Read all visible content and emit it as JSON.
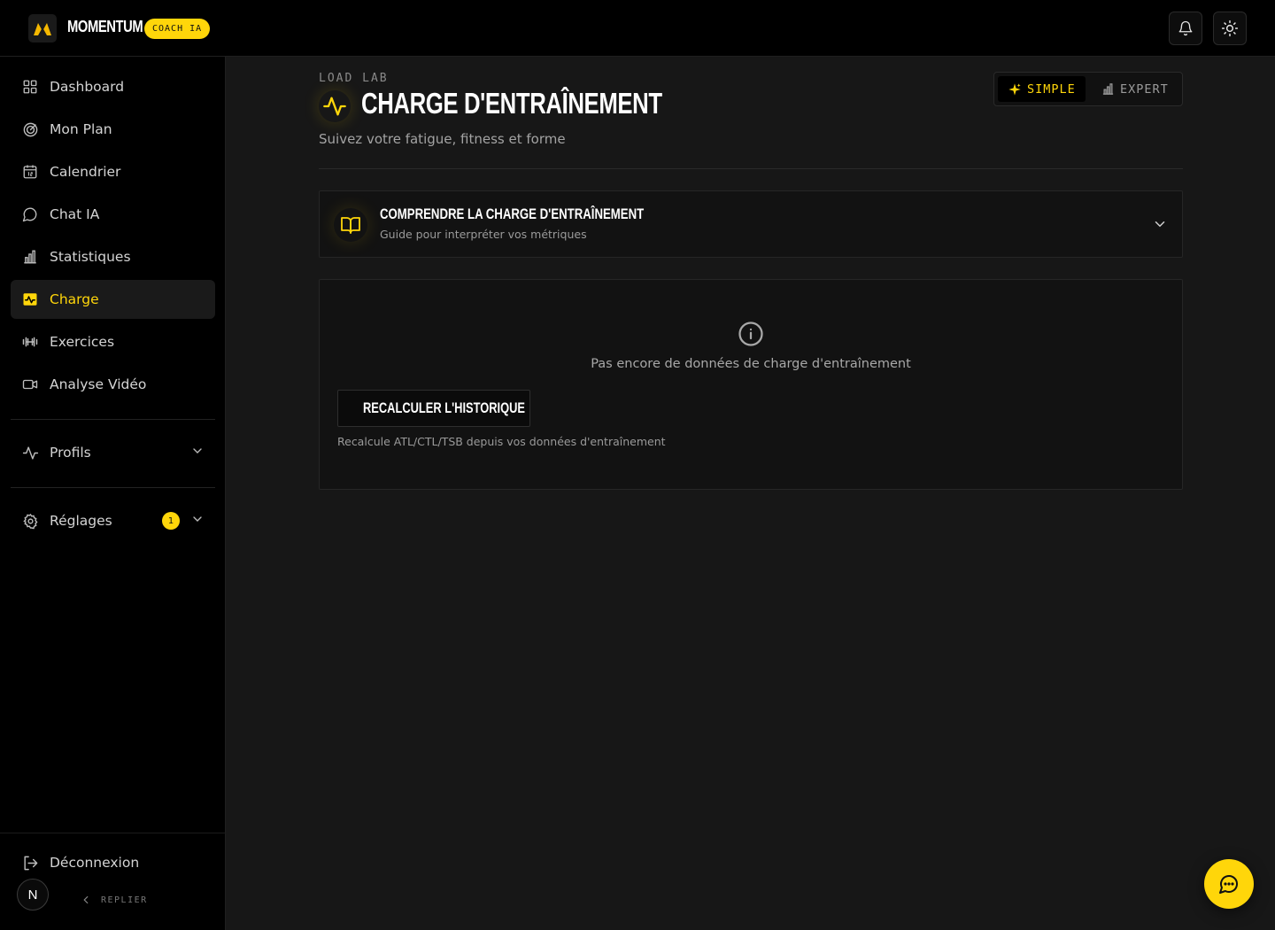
{
  "app": {
    "brand": "MOMENTUM",
    "badge": "COACH IA"
  },
  "sidebar": {
    "items": [
      {
        "label": "Dashboard",
        "icon": "grid-icon"
      },
      {
        "label": "Mon Plan",
        "icon": "target-icon"
      },
      {
        "label": "Calendrier",
        "icon": "calendar-icon"
      },
      {
        "label": "Chat IA",
        "icon": "chat-bubble-icon"
      },
      {
        "label": "Statistiques",
        "icon": "bar-chart-icon"
      },
      {
        "label": "Charge",
        "icon": "activity-icon",
        "active": true
      },
      {
        "label": "Exercices",
        "icon": "dumbbell-icon"
      },
      {
        "label": "Analyse Vidéo",
        "icon": "video-icon"
      }
    ],
    "profils": {
      "label": "Profils"
    },
    "reglages": {
      "label": "Réglages",
      "badge": "1"
    },
    "logout": {
      "label": "Déconnexion"
    },
    "avatar": "N",
    "collapse": "REPLIER"
  },
  "header": {
    "eyebrow": "LOAD LAB",
    "title": "CHARGE D'ENTRAÎNEMENT",
    "subtitle": "Suivez votre fatigue, fitness et forme",
    "mode": {
      "simple": "SIMPLE",
      "expert": "EXPERT",
      "selected": "SIMPLE"
    }
  },
  "guide": {
    "title": "COMPRENDRE LA CHARGE D'ENTRAÎNEMENT",
    "subtitle": "Guide pour interpréter vos métriques"
  },
  "empty_state": {
    "message": "Pas encore de données de charge d'entraînement",
    "button": "RECALCULER L'HISTORIQUE",
    "note": "Recalcule ATL/CTL/TSB depuis vos données d'entraînement"
  },
  "colors": {
    "accent": "#ffd60a",
    "background": "#171717",
    "sidebar": "#000000"
  }
}
